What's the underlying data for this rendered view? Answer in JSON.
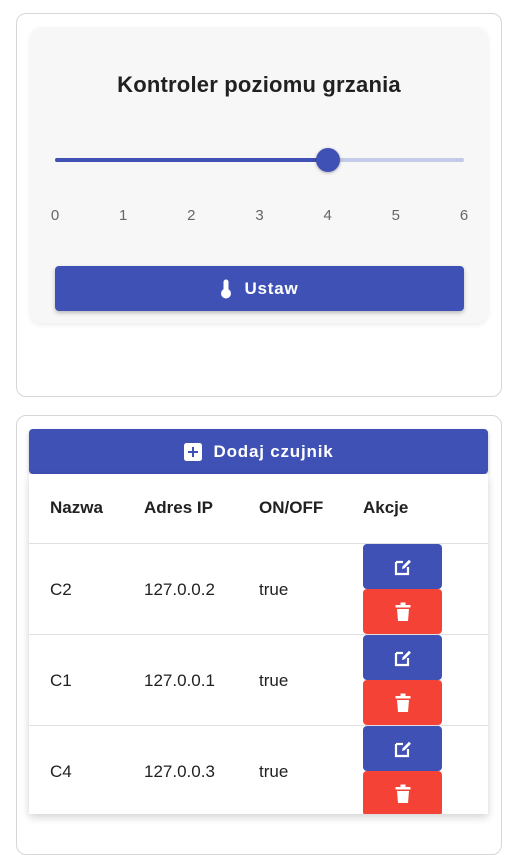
{
  "heater": {
    "title": "Kontroler poziomu grzania",
    "slider_value": 4,
    "slider_min": 0,
    "slider_max": 6,
    "ticks": [
      "0",
      "1",
      "2",
      "3",
      "4",
      "5",
      "6"
    ],
    "set_label": "Ustaw"
  },
  "sensors": {
    "add_label": "Dodaj czujnik",
    "headers": {
      "name": "Nazwa",
      "ip": "Adres IP",
      "onoff": "ON/OFF",
      "actions": "Akcje"
    },
    "rows": [
      {
        "name": "C2",
        "ip": "127.0.0.2",
        "onoff": "true"
      },
      {
        "name": "C1",
        "ip": "127.0.0.1",
        "onoff": "true"
      },
      {
        "name": "C4",
        "ip": "127.0.0.3",
        "onoff": "true"
      }
    ]
  },
  "colors": {
    "primary": "#3f51b5",
    "primary_light": "#c5cae9",
    "danger": "#f44336"
  },
  "icons": {
    "set_button": "thermometer-icon",
    "add_button": "plus-box-icon",
    "edit_action": "edit-icon",
    "delete_action": "trash-icon"
  }
}
